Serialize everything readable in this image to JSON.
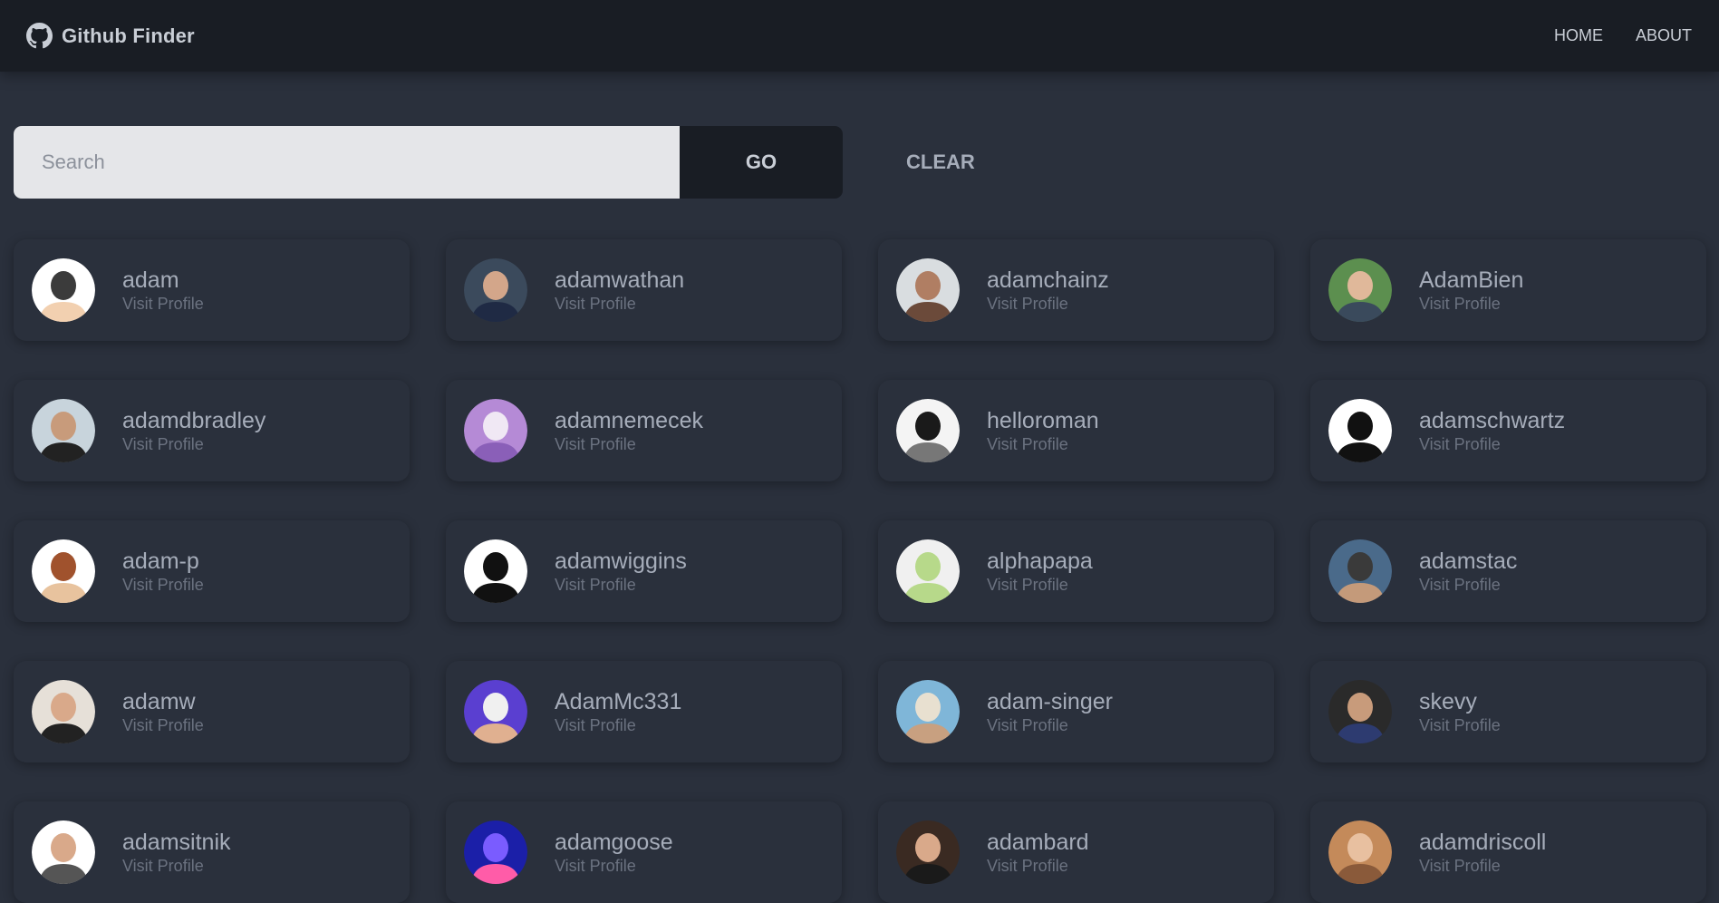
{
  "navbar": {
    "brand_icon": "github-icon",
    "title": "Github Finder",
    "links": [
      "HOME",
      "ABOUT"
    ]
  },
  "search": {
    "placeholder": "Search",
    "value": "",
    "go_label": "GO",
    "clear_label": "CLEAR"
  },
  "colors": {
    "background": "#2a303c",
    "navbar": "#191d24",
    "input": "#e5e6e9",
    "text": "#a6adba",
    "muted": "#6b7280"
  },
  "users": [
    {
      "login": "adam",
      "link": "Visit Profile",
      "avatar": {
        "bg": "#ffffff",
        "fg": "#3b3b3b",
        "accent": "#f2d0b0"
      }
    },
    {
      "login": "adamwathan",
      "link": "Visit Profile",
      "avatar": {
        "bg": "#3b4a5c",
        "fg": "#d3a68a",
        "accent": "#1f2a44"
      }
    },
    {
      "login": "adamchainz",
      "link": "Visit Profile",
      "avatar": {
        "bg": "#d9dde0",
        "fg": "#b07e63",
        "accent": "#6b4a3a"
      }
    },
    {
      "login": "AdamBien",
      "link": "Visit Profile",
      "avatar": {
        "bg": "#5c8f4f",
        "fg": "#e0b89a",
        "accent": "#3a4a5c"
      }
    },
    {
      "login": "adamdbradley",
      "link": "Visit Profile",
      "avatar": {
        "bg": "#c8d4dc",
        "fg": "#c89b7b",
        "accent": "#222222"
      }
    },
    {
      "login": "adamnemecek",
      "link": "Visit Profile",
      "avatar": {
        "bg": "#b58ad6",
        "fg": "#f0e8f4",
        "accent": "#8a5fb8"
      }
    },
    {
      "login": "helloroman",
      "link": "Visit Profile",
      "avatar": {
        "bg": "#f4f4f4",
        "fg": "#1a1a1a",
        "accent": "#777777"
      }
    },
    {
      "login": "adamschwartz",
      "link": "Visit Profile",
      "avatar": {
        "bg": "#ffffff",
        "fg": "#111111",
        "accent": "#111111"
      }
    },
    {
      "login": "adam-p",
      "link": "Visit Profile",
      "avatar": {
        "bg": "#ffffff",
        "fg": "#a0522d",
        "accent": "#e8c39e"
      }
    },
    {
      "login": "adamwiggins",
      "link": "Visit Profile",
      "avatar": {
        "bg": "#ffffff",
        "fg": "#111111",
        "accent": "#111111"
      }
    },
    {
      "login": "alphapapa",
      "link": "Visit Profile",
      "avatar": {
        "bg": "#f0f0f0",
        "fg": "#b7d98a",
        "accent": "#b7d98a"
      }
    },
    {
      "login": "adamstac",
      "link": "Visit Profile",
      "avatar": {
        "bg": "#4a6a8a",
        "fg": "#3a3a3a",
        "accent": "#c49a7a"
      }
    },
    {
      "login": "adamw",
      "link": "Visit Profile",
      "avatar": {
        "bg": "#e6e0d8",
        "fg": "#d9a98a",
        "accent": "#222222"
      }
    },
    {
      "login": "AdamMc331",
      "link": "Visit Profile",
      "avatar": {
        "bg": "#5a3fd0",
        "fg": "#f0f0f0",
        "accent": "#e0b090"
      }
    },
    {
      "login": "adam-singer",
      "link": "Visit Profile",
      "avatar": {
        "bg": "#7fb6d8",
        "fg": "#e8e0d0",
        "accent": "#c8a080"
      }
    },
    {
      "login": "skevy",
      "link": "Visit Profile",
      "avatar": {
        "bg": "#2a2a2a",
        "fg": "#c89b7b",
        "accent": "#2d3b70"
      }
    },
    {
      "login": "adamsitnik",
      "link": "Visit Profile",
      "avatar": {
        "bg": "#ffffff",
        "fg": "#d9a98a",
        "accent": "#555555"
      }
    },
    {
      "login": "adamgoose",
      "link": "Visit Profile",
      "avatar": {
        "bg": "#1b1fa8",
        "fg": "#7a5cff",
        "accent": "#ff5ca8"
      }
    },
    {
      "login": "adambard",
      "link": "Visit Profile",
      "avatar": {
        "bg": "#3a2a22",
        "fg": "#d9a98a",
        "accent": "#1a1a1a"
      }
    },
    {
      "login": "adamdriscoll",
      "link": "Visit Profile",
      "avatar": {
        "bg": "#c48a5a",
        "fg": "#e8c0a0",
        "accent": "#8a5a3a"
      }
    }
  ]
}
